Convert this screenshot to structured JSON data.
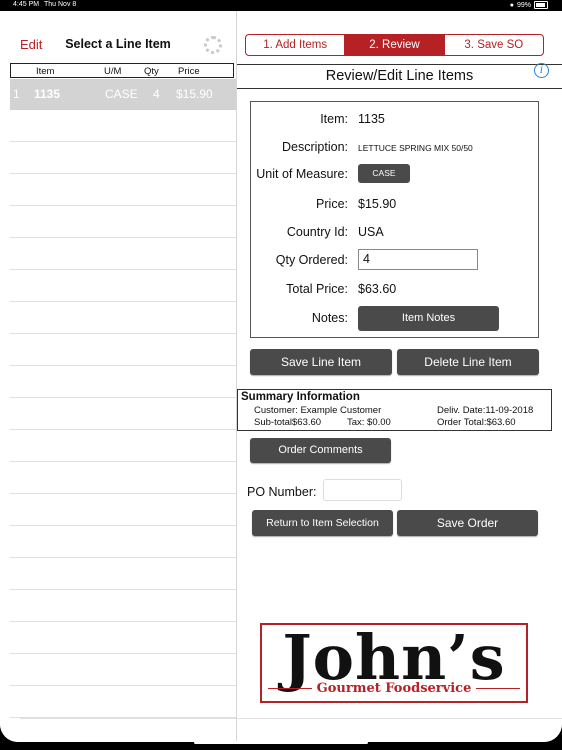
{
  "status": {
    "time": "4:45 PM",
    "date": "Thu Nov 8",
    "battery": "99%"
  },
  "left": {
    "edit_label": "Edit",
    "title": "Select a Line Item",
    "columns": {
      "item": "Item",
      "um": "U/M",
      "qty": "Qty",
      "price": "Price"
    },
    "rows": [
      {
        "index": "1",
        "item": "1135",
        "um": "CASE",
        "qty": "4",
        "price": "$15.90"
      }
    ]
  },
  "steps": {
    "add": "1. Add Items",
    "review": "2. Review",
    "save": "3. Save SO"
  },
  "review_title": "Review/Edit Line Items",
  "info_icon": "i",
  "detail": {
    "item_label": "Item:",
    "item_value": "1135",
    "desc_label": "Description:",
    "desc_value": "LETTUCE SPRING MIX 50/50",
    "uom_label": "Unit of Measure:",
    "uom_value": "CASE",
    "price_label": "Price:",
    "price_value": "$15.90",
    "country_label": "Country Id:",
    "country_value": "USA",
    "qty_label": "Qty Ordered:",
    "qty_value": "4",
    "total_label": "Total Price:",
    "total_value": "$63.60",
    "notes_label": "Notes:",
    "notes_button": "Item Notes"
  },
  "actions": {
    "save_line": "Save Line Item",
    "delete_line": "Delete Line Item"
  },
  "summary": {
    "title": "Summary Information",
    "customer": "Customer: Example Customer",
    "deliv_date": "Deliv. Date:11-09-2018",
    "subtotal": "Sub-total$63.60",
    "tax": "Tax: $0.00",
    "order_total": "Order Total:$63.60"
  },
  "order_comments": "Order Comments",
  "po_label": "PO Number:",
  "po_value": "",
  "return_button": "Return to Item Selection",
  "save_order_button": "Save Order",
  "logo": {
    "main": "John’s",
    "sub": "Gourmet Foodservice"
  },
  "colors": {
    "accent": "#b52125",
    "button_dark": "#4a4a4a",
    "selected_row": "#d3d3d3"
  }
}
